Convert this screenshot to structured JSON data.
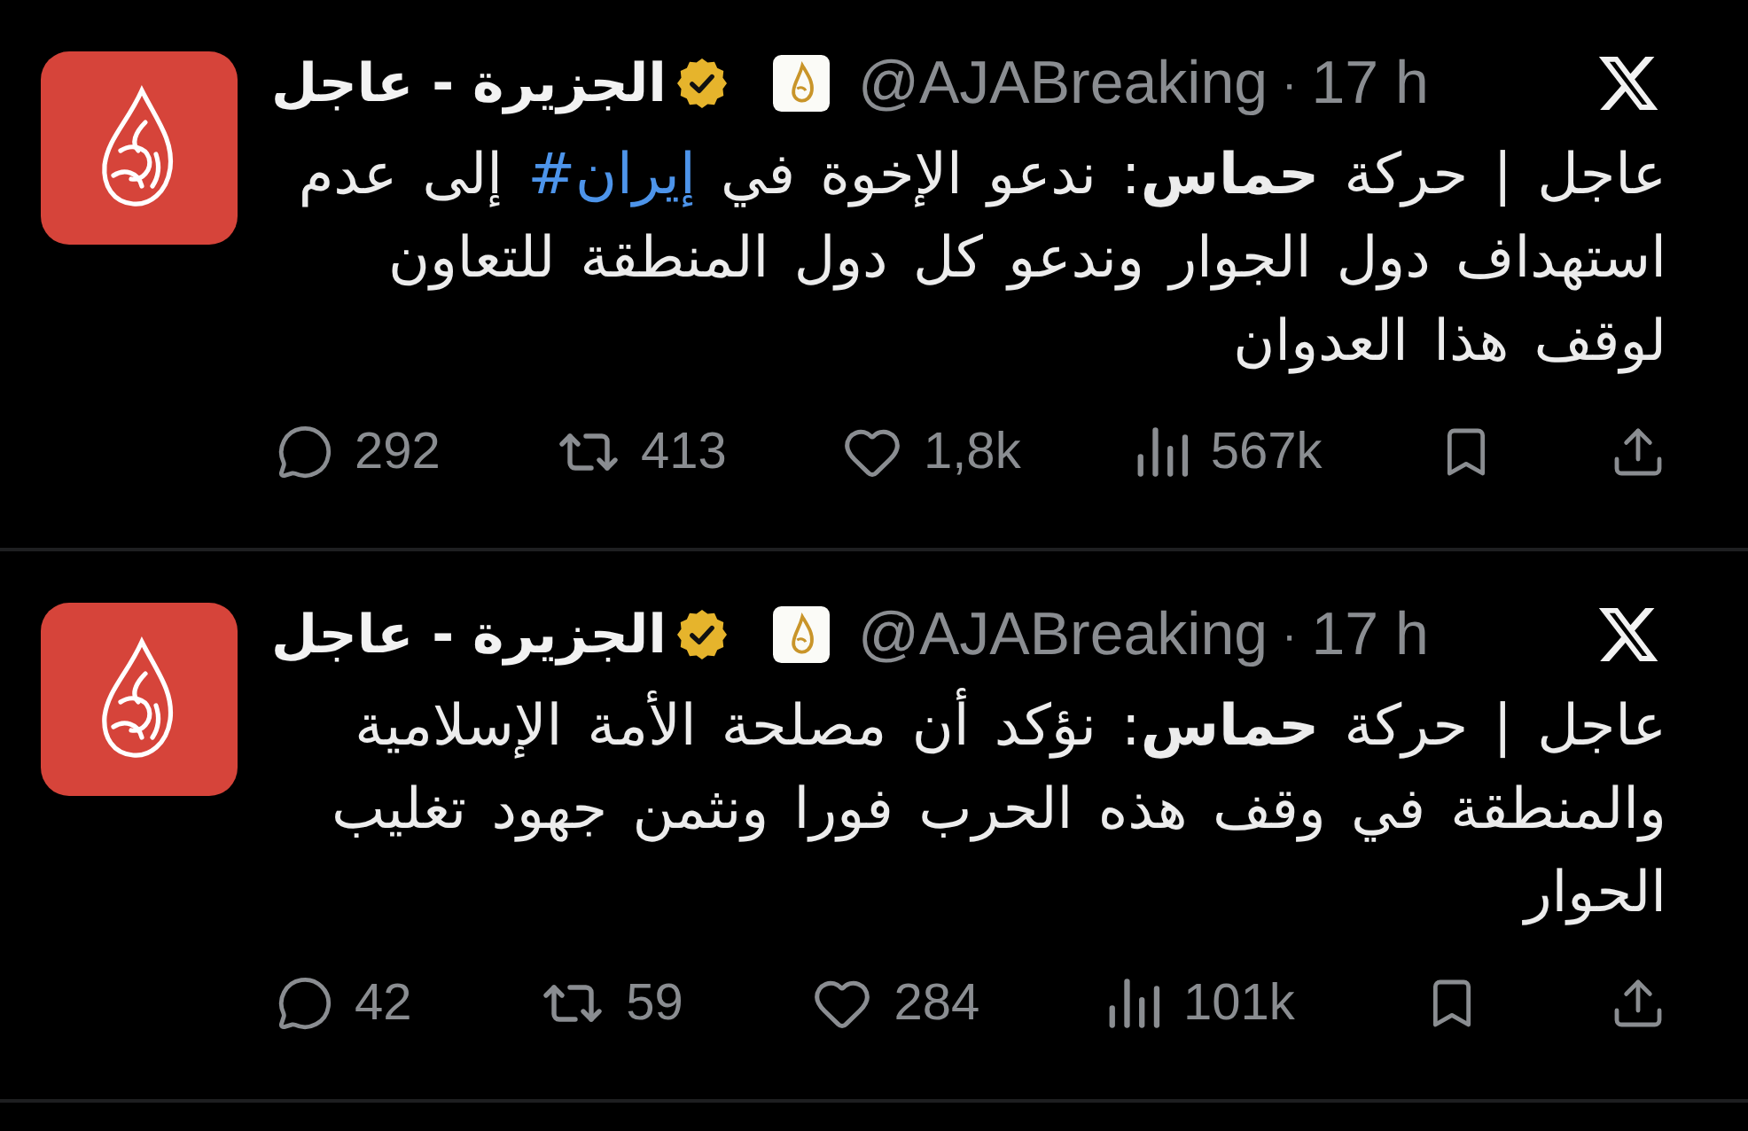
{
  "tweets": [
    {
      "author": {
        "name": "الجزيرة - عاجل",
        "verified": true,
        "affiliate": true,
        "handle": "@AJABreaking",
        "separator": "·",
        "time": "17 h"
      },
      "body": [
        {
          "kind": "text",
          "text": "عاجل | حركة **حماس**: ندعو الإخوة في "
        },
        {
          "kind": "hashtag",
          "text": "#إيران"
        },
        {
          "kind": "text",
          "text": " إلى عدم"
        },
        {
          "kind": "break"
        },
        {
          "kind": "text",
          "text": "استهداف دول الجوار وندعو كل دول المنطقة للتعاون"
        },
        {
          "kind": "break"
        },
        {
          "kind": "text",
          "text": "لوقف هذا العدوان"
        }
      ],
      "actions": [
        {
          "kind": "share"
        },
        {
          "kind": "bookmark"
        },
        {
          "kind": "views",
          "count": "567k"
        },
        {
          "kind": "like",
          "count": "1,8k"
        },
        {
          "kind": "repost",
          "count": "413"
        },
        {
          "kind": "reply",
          "count": "292"
        }
      ]
    },
    {
      "author": {
        "name": "الجزيرة - عاجل",
        "verified": true,
        "affiliate": true,
        "handle": "@AJABreaking",
        "separator": "·",
        "time": "17 h"
      },
      "body": [
        {
          "kind": "text",
          "text": "عاجل | حركة **حماس**: نؤكد أن مصلحة الأمة الإسلامية"
        },
        {
          "kind": "break"
        },
        {
          "kind": "text",
          "text": "والمنطقة في وقف هذه الحرب فورا ونثمن جهود تغليب"
        },
        {
          "kind": "break"
        },
        {
          "kind": "text",
          "text": "الحوار"
        }
      ],
      "actions": [
        {
          "kind": "share"
        },
        {
          "kind": "bookmark"
        },
        {
          "kind": "views",
          "count": "101k"
        },
        {
          "kind": "like",
          "count": "284"
        },
        {
          "kind": "repost",
          "count": "59"
        },
        {
          "kind": "reply",
          "count": "42"
        }
      ]
    }
  ]
}
